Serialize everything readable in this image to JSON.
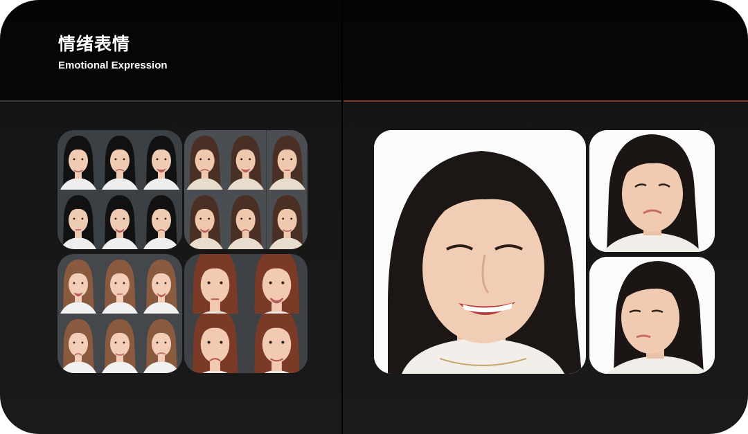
{
  "header": {
    "title_cn": "情绪表情",
    "title_en": "Emotional Expression"
  },
  "colors": {
    "background": "#0a0a0a",
    "divider_left": "#3a3a3a",
    "divider_right": "#8a3a2c",
    "text": "#ffffff"
  },
  "grids": [
    {
      "id": "grid-top-left",
      "bg": "#3b4045",
      "skin": "#f0cbb3",
      "hair": "#111111",
      "shirt": "#eeeeee",
      "rows": 2,
      "cols": 3
    },
    {
      "id": "grid-top-right",
      "bg": "#4a4d52",
      "skin": "#efc8ae",
      "hair": "#4a3024",
      "shirt": "#e8dccd",
      "rows": 2,
      "cols": 3
    },
    {
      "id": "grid-bottom-left",
      "bg": "#44474b",
      "skin": "#f3cdb8",
      "hair": "#8a5a3e",
      "shirt": "#f1f1f1",
      "rows": 2,
      "cols": 3
    },
    {
      "id": "grid-bottom-right",
      "bg": "#3e4146",
      "skin": "#f2c9b1",
      "hair": "#7a3a26",
      "shirt": "#e9e4df",
      "rows": 2,
      "cols": 2
    }
  ],
  "photos": [
    {
      "id": "portrait-smiling",
      "expression": "smile"
    },
    {
      "id": "portrait-sad",
      "expression": "sad"
    },
    {
      "id": "portrait-side",
      "expression": "neutral"
    }
  ]
}
